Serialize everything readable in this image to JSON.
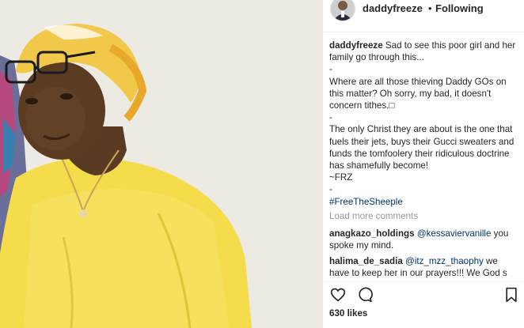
{
  "header": {
    "username": "daddyfreeze",
    "separator": "•",
    "follow_status": "Following"
  },
  "caption": {
    "username": "daddyfreeze",
    "line1": "Sad to see this poor girl and her family go through this...",
    "dash1": "-",
    "line2": "Where are all those thieving Daddy GOs on this matter? Oh sorry, my bad, it doesn't concern tithes.",
    "dash2": "-",
    "line3": "The only Christ they are about is the one that fuels their jets, buys their Gucci sweaters and funds the tomfoolery their ridiculous doctrine has shamefully become!",
    "signature": "~FRZ",
    "dash3": "-",
    "hashtag": "#FreeTheSheeple"
  },
  "load_more": "Load more comments",
  "comments": [
    {
      "username": "anagkazo_holdings",
      "mention": "@kessavierv​anille",
      "text": " you spoke my mind."
    },
    {
      "username": "halima_de_sadia",
      "mention": "@itz_mzz_thaophy",
      "text": " we have to keep her in our prayers!!! We God s"
    }
  ],
  "actions": {
    "like_icon": "heart-outline-icon",
    "comment_icon": "speech-bubble-icon",
    "save_icon": "bookmark-icon"
  },
  "likes": "630 likes",
  "colors": {
    "text": "#262626",
    "link": "#003569",
    "muted": "#999999",
    "dress": "#f4dc4a",
    "headwrap": "#f1c84a"
  }
}
